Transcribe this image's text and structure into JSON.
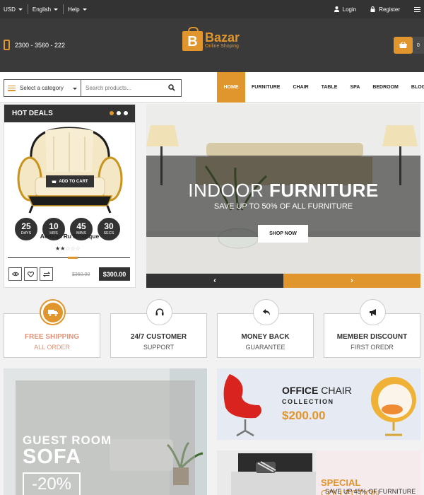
{
  "topbar": {
    "currency": "USD",
    "language": "English",
    "help": "Help",
    "login": "Login",
    "register": "Register"
  },
  "header": {
    "phone": "2300 - 3560 - 222",
    "logo_letter": "B",
    "logo_name": "Bazar",
    "logo_sub": "Online Shoping",
    "cart_count": "0"
  },
  "search": {
    "category": "Select a category",
    "placeholder": "Search products..."
  },
  "menu": [
    "HOME",
    "FURNITURE",
    "CHAIR",
    "TABLE",
    "SPA",
    "BEDROOM",
    "BLOG"
  ],
  "hot_deals": {
    "title": "HOT DEALS",
    "add_to_cart": "ADD TO CART",
    "timer": [
      {
        "value": "25",
        "label": "DAYS"
      },
      {
        "value": "10",
        "label": "HRS"
      },
      {
        "value": "45",
        "label": "MINS"
      },
      {
        "value": "30",
        "label": "SECS"
      }
    ],
    "product_name": "Aenean Ru Bristique",
    "rating": 2,
    "rating_max": 5,
    "old_price": "$350.00",
    "new_price": "$300.00"
  },
  "slider": {
    "title_light": "INDOOR",
    "title_bold": "FURNITURE",
    "subtitle": "SAVE UP TO 50% OF ALL FURNITURE",
    "button": "SHOP NOW",
    "prev": "‹",
    "next": "›"
  },
  "features": [
    {
      "title": "FREE SHIPPING",
      "subtitle": "ALL ORDER",
      "icon": "truck-icon"
    },
    {
      "title": "24/7 CUSTOMER",
      "subtitle": "SUPPORT",
      "icon": "headset-icon"
    },
    {
      "title": "MONEY BACK",
      "subtitle": "GUARANTEE",
      "icon": "return-icon"
    },
    {
      "title": "MEMBER DISCOUNT",
      "subtitle": "FIRST OREDR",
      "icon": "megaphone-icon"
    }
  ],
  "banner_guest": {
    "line1": "GUEST ROOM",
    "line2": "SOFA",
    "discount": "-20%"
  },
  "banner_office": {
    "title_bold": "OFFICE",
    "title_light": "CHAIR",
    "subtitle": "COLLECTION",
    "price": "$200.00"
  },
  "banner_special": {
    "title_bold": "SPECIAL",
    "title_light": "COLLECTION",
    "subtitle": "SAVE UP 45% OF FURNITURE"
  },
  "colors": {
    "accent": "#e0952d",
    "dark": "#333333",
    "header_bg": "#3a3a3a"
  }
}
